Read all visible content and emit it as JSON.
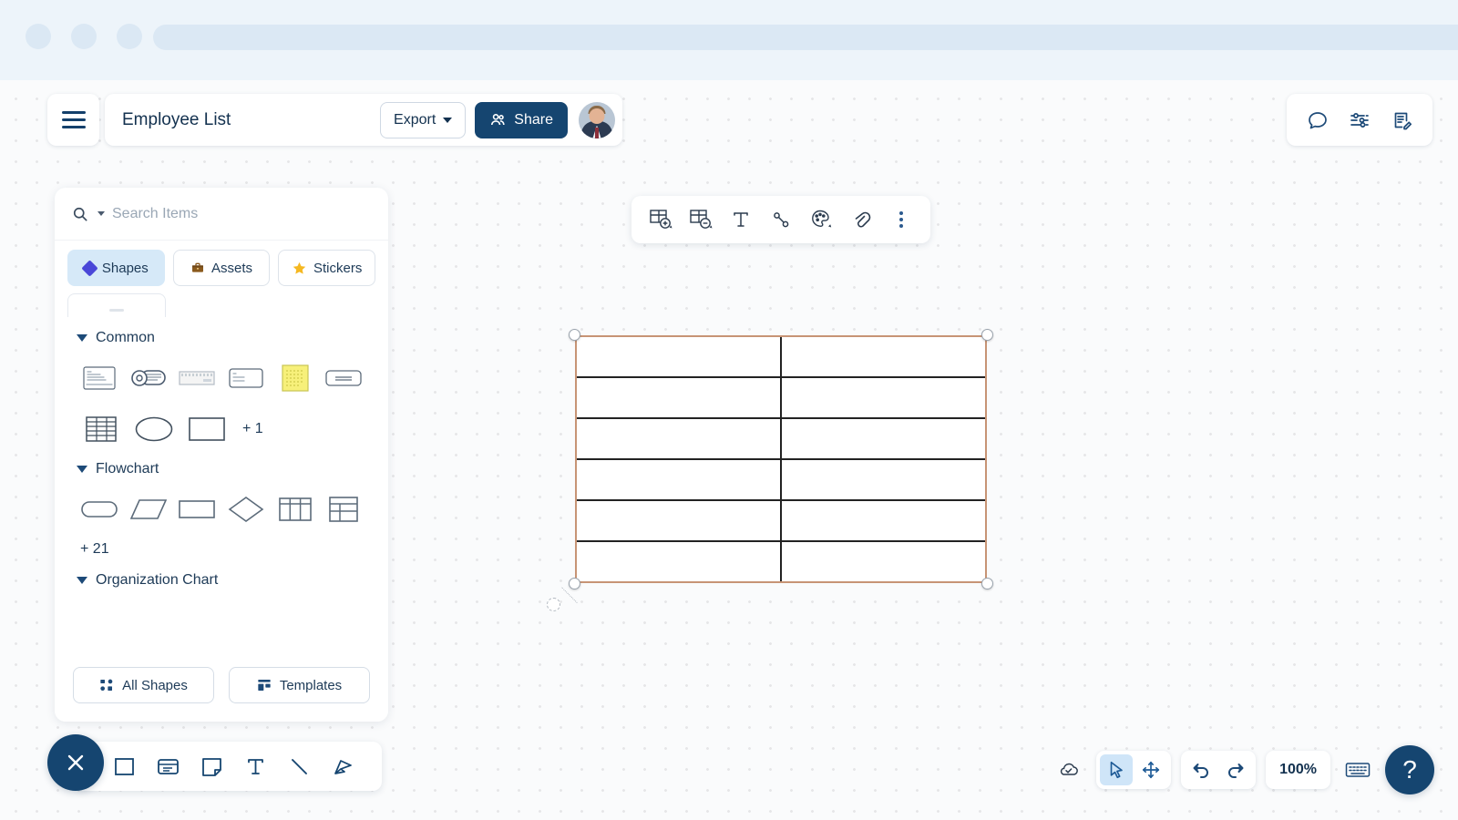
{
  "browser": {
    "dots": [
      "dot-1",
      "dot-2",
      "dot-3"
    ]
  },
  "header": {
    "menu_icon": "hamburger-menu-icon",
    "title": "Employee List",
    "export_label": "Export",
    "share_label": "Share",
    "avatar_alt": "user-avatar"
  },
  "header_right": {
    "comment_icon": "comment-bubble-icon",
    "settings_icon": "sliders-settings-icon",
    "notes_icon": "notes-edit-icon"
  },
  "search": {
    "icon": "search-icon",
    "placeholder": "Search Items",
    "value": ""
  },
  "tabs": [
    {
      "label": "Shapes",
      "icon": "diamond-icon",
      "active": true
    },
    {
      "label": "Assets",
      "icon": "briefcase-icon",
      "active": false
    },
    {
      "label": "Stickers",
      "icon": "star-icon",
      "active": false
    }
  ],
  "shape_groups": [
    {
      "title": "Common",
      "expanded": true,
      "rows": [
        [
          "note-card-shape",
          "tag-label-shape",
          "ruler-card-shape",
          "small-card-shape",
          "sticky-note-shape",
          "rounded-card-shape"
        ],
        [
          "grid-table-shape",
          "ellipse-shape",
          "rectangle-shape"
        ]
      ],
      "more_label": "+ 1",
      "more_inline": true
    },
    {
      "title": "Flowchart",
      "expanded": true,
      "rows": [
        [
          "terminator-shape",
          "parallelogram-shape",
          "process-rectangle-shape",
          "decision-diamond-shape",
          "table-three-column-shape",
          "table-split-shape"
        ]
      ],
      "more_label": "+ 21",
      "more_inline": false
    },
    {
      "title": "Organization Chart",
      "expanded": true,
      "rows": [],
      "more_label": "",
      "more_inline": false
    }
  ],
  "panel_footer": {
    "all_shapes_label": "All Shapes",
    "all_shapes_icon": "shapes-grid-icon",
    "templates_label": "Templates",
    "templates_icon": "template-layout-icon"
  },
  "canvas_toolbar": [
    {
      "name": "add-table-row-icon",
      "label": "Add Row"
    },
    {
      "name": "remove-table-row-icon",
      "label": "Remove Row"
    },
    {
      "name": "text-icon",
      "label": "Text"
    },
    {
      "name": "connector-line-icon",
      "label": "Connector"
    },
    {
      "name": "color-palette-icon",
      "label": "Color"
    },
    {
      "name": "link-icon",
      "label": "Link"
    },
    {
      "name": "more-options-icon",
      "label": "More"
    }
  ],
  "selected_object": {
    "type": "table",
    "rows": 6,
    "columns": 2,
    "selection_color": "#c79475",
    "grid_color": "#222222",
    "cells": [
      [
        "",
        ""
      ],
      [
        "",
        ""
      ],
      [
        "",
        ""
      ],
      [
        "",
        ""
      ],
      [
        "",
        ""
      ],
      [
        "",
        ""
      ]
    ],
    "handles": [
      "top-left",
      "top-right",
      "bottom-left",
      "bottom-right",
      "rotate"
    ]
  },
  "bottom_left_tools": {
    "close_icon": "close-x-icon",
    "tools": [
      {
        "name": "rectangle-tool-icon",
        "label": "Rectangle"
      },
      {
        "name": "card-tool-icon",
        "label": "Card"
      },
      {
        "name": "sticky-note-tool-icon",
        "label": "Sticky Note"
      },
      {
        "name": "text-tool-icon",
        "label": "Text"
      },
      {
        "name": "line-tool-icon",
        "label": "Line"
      },
      {
        "name": "pen-tool-icon",
        "label": "Pen"
      }
    ]
  },
  "bottom_right": {
    "cloud_icon": "cloud-saved-icon",
    "cursor_icon": "cursor-select-icon",
    "pan_icon": "pan-move-icon",
    "undo_icon": "undo-icon",
    "redo_icon": "redo-icon",
    "zoom_level": "100%",
    "keyboard_icon": "keyboard-shortcuts-icon",
    "help_label": "?"
  },
  "colors": {
    "navy": "#154570",
    "accent_blue": "#cfe5f8",
    "selection_tan": "#c79475",
    "chrome_bg": "#edf4fa",
    "canvas_bg": "#fafbfc"
  }
}
